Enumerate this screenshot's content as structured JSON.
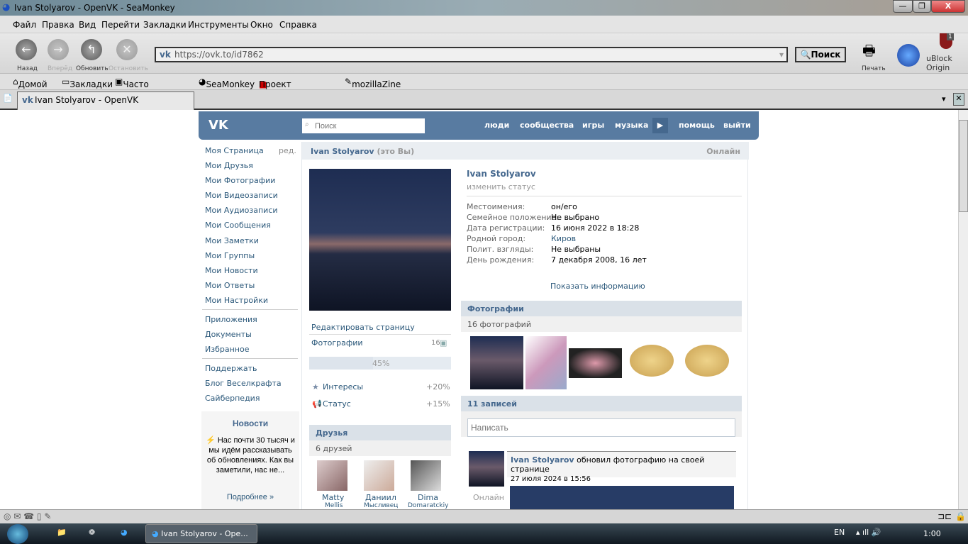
{
  "window": {
    "title": "Ivan Stolyarov - OpenVK - SeaMonkey",
    "minimize": "—",
    "restore": "❐",
    "close": "X"
  },
  "menu": [
    "Файл",
    "Правка",
    "Вид",
    "Перейти",
    "Закладки",
    "Инструменты",
    "Окно",
    "Справка"
  ],
  "nav": {
    "back": "Назад",
    "forward": "Вперёд",
    "reload": "Обновить",
    "stop": "Остановить",
    "url": "https://ovk.to/id7862",
    "search": "Поиск",
    "print": "Печать",
    "ublock": "uBlock Origin",
    "ublock_badge": "1"
  },
  "bookmarks": [
    "Домой",
    "Закладки",
    "Часто посещае...",
    "SeaMonkey",
    "Проект SeaMon...",
    "mozillaZine"
  ],
  "tab": {
    "label": "Ivan Stolyarov - OpenVK"
  },
  "vk": {
    "logo": "VK",
    "search_placeholder": "Поиск",
    "nav": [
      "люди",
      "сообщества",
      "игры",
      "музыка",
      "помощь",
      "выйти"
    ],
    "left_menu": [
      "Моя Страница",
      "Мои Друзья",
      "Мои Фотографии",
      "Мои Видеозаписи",
      "Мои Аудиозаписи",
      "Мои Сообщения",
      "Мои Заметки",
      "Мои Группы",
      "Мои Новости",
      "Мои Ответы",
      "Мои Настройки",
      "Приложения",
      "Документы",
      "Избранное",
      "Поддержать",
      "Блог Веселкрафта",
      "Сайберпедия"
    ],
    "edit_short": "ред.",
    "news": {
      "title": "Новости",
      "text": "⚡ Нас почти 30 тысяч и мы идём рассказывать об обновлениях. Как вы заметили, нас не...",
      "more": "Подробнее »"
    },
    "page_title": "Ivan Stolyarov",
    "page_title_suffix": "(это Вы)",
    "online": "Онлайн",
    "edit_page": "Редактировать страницу",
    "photos_label": "Фотографии",
    "photos_count": "16",
    "completion": {
      "percent": 45,
      "text": "45%"
    },
    "boosts": [
      {
        "label": "Интересы",
        "value": "+20%"
      },
      {
        "label": "Статус",
        "value": "+15%"
      }
    ],
    "friends": {
      "title": "Друзья",
      "count": "6 друзей",
      "items": [
        {
          "first": "Matty",
          "last": "Mellis"
        },
        {
          "first": "Даниил",
          "last": "Мысливец"
        },
        {
          "first": "Dima",
          "last": "Domaratckiy"
        }
      ]
    },
    "name": "Ivan Stolyarov",
    "change_status": "изменить статус",
    "info": [
      {
        "k": "Местоимения:",
        "v": "он/его"
      },
      {
        "k": "Семейное положение:",
        "v": "Не выбрано"
      },
      {
        "k": "Дата регистрации:",
        "v": "16 июня 2022 в 18:28"
      },
      {
        "k": "Родной город:",
        "v": "Киров"
      },
      {
        "k": "Полит. взгляды:",
        "v": "Не выбраны"
      },
      {
        "k": "День рождения:",
        "v": "7 декабря 2008, 16 лет"
      }
    ],
    "show_info": "Показать информацию",
    "photos": {
      "title": "Фотографии",
      "count": "16 фотографий"
    },
    "wall": {
      "title": "11 записей",
      "placeholder": "Написать",
      "post": {
        "author": "Ivan Stolyarov",
        "action": "обновил фотографию на своей странице",
        "date": "27 июля 2024 в 15:56",
        "status": "Онлайн"
      }
    }
  },
  "taskbar": {
    "task": "Ivan Stolyarov - Ope...",
    "lang": "EN",
    "time": "1:00"
  }
}
